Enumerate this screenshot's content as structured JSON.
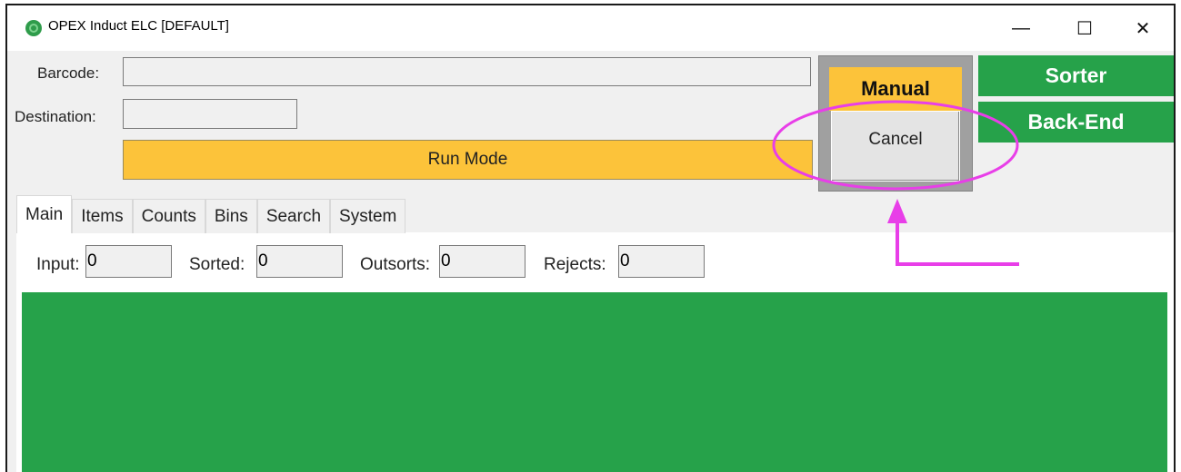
{
  "window": {
    "title": "OPEX Induct ELC [DEFAULT]",
    "minimize_glyph": "—",
    "maximize_glyph": "☐",
    "close_glyph": "✕"
  },
  "form": {
    "barcode_label": "Barcode:",
    "barcode_value": "",
    "destination_label": "Destination:",
    "destination_value": "",
    "run_mode_label": "Run Mode"
  },
  "manual_panel": {
    "manual_label": "Manual",
    "cancel_label": "Cancel"
  },
  "side_buttons": {
    "sorter_label": "Sorter",
    "backend_label": "Back-End"
  },
  "tabs": [
    {
      "label": "Main"
    },
    {
      "label": "Items"
    },
    {
      "label": "Counts"
    },
    {
      "label": "Bins"
    },
    {
      "label": "Search"
    },
    {
      "label": "System"
    }
  ],
  "counters": {
    "input_label": "Input:",
    "input_value": "0",
    "sorted_label": "Sorted:",
    "sorted_value": "0",
    "outsorts_label": "Outsorts:",
    "outsorts_value": "0",
    "rejects_label": "Rejects:",
    "rejects_value": "0"
  },
  "colors": {
    "run_mode": "#fcc33a",
    "status_green": "#26a24a",
    "annotation": "#e83ee8"
  },
  "icons": {
    "app": "opex-logo-icon"
  }
}
